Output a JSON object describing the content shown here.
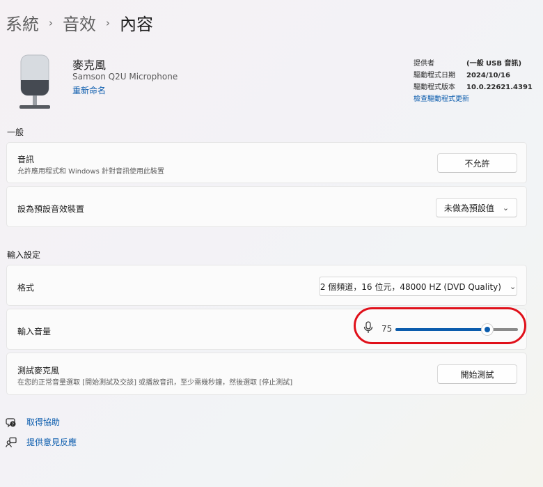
{
  "breadcrumb": {
    "level1": "系統",
    "level2": "音效",
    "current": "內容",
    "separator": "›"
  },
  "device": {
    "name": "麥克風",
    "model": "Samson Q2U Microphone",
    "rename_label": "重新命名"
  },
  "driver_info": {
    "provider_label": "提供者",
    "provider_value": "(一般 USB 音訊)",
    "date_label": "驅動程式日期",
    "date_value": "2024/10/16",
    "version_label": "驅動程式版本",
    "version_value": "10.0.22621.4391",
    "update_link": "檢查驅動程式更新"
  },
  "general": {
    "heading": "一般",
    "audio": {
      "title": "音訊",
      "subtitle": "允許應用程式和 Windows 針對音訊使用此裝置",
      "button": "不允許"
    },
    "default_device": {
      "title": "設為預設音效裝置",
      "button": "未做為預設值",
      "chevron": "⌄"
    }
  },
  "input_settings": {
    "heading": "輸入設定",
    "format": {
      "title": "格式",
      "value": "2 個頻道，16 位元，48000 HZ (DVD Quality)",
      "chevron": "⌄"
    },
    "volume": {
      "title": "輸入音量",
      "value": "75",
      "level": 75,
      "icon": "microphone-icon"
    },
    "test": {
      "title": "測試麥克風",
      "subtitle": "在您的正常音量選取 [開始測試及交談] 或播放音訊，至少需幾秒鐘，然後選取 [停止測試]",
      "button": "開始測試"
    }
  },
  "footer": {
    "help": "取得協助",
    "feedback": "提供意見反應"
  },
  "colors": {
    "accent": "#0b5cad",
    "highlight_ring": "#e0101a"
  }
}
